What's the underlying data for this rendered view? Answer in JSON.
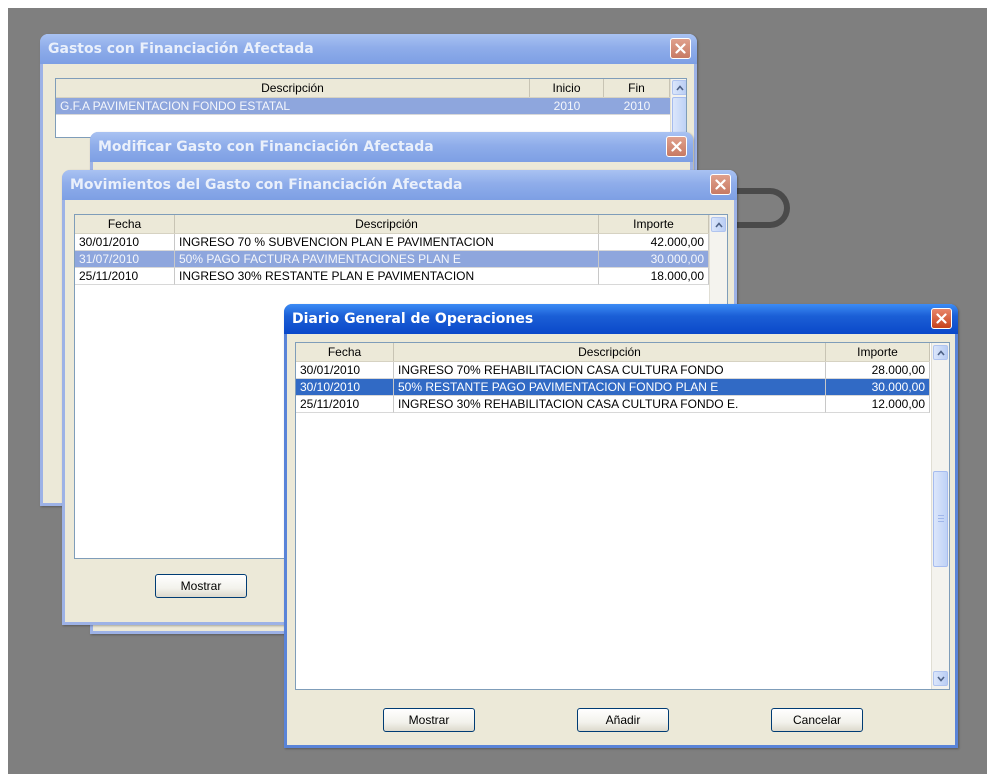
{
  "windows": {
    "gastos": {
      "title": "Gastos con Financiación Afectada",
      "columns": [
        "Descripción",
        "Inicio",
        "Fin"
      ],
      "rows": [
        {
          "descripcion": "G.F.A PAVIMENTACION FONDO ESTATAL",
          "inicio": "2010",
          "fin": "2010"
        }
      ]
    },
    "modificar": {
      "title": "Modificar Gasto con Financiación Afectada"
    },
    "movimientos": {
      "title": "Movimientos del Gasto con Financiación Afectada",
      "columns": [
        "Fecha",
        "Descripción",
        "Importe"
      ],
      "rows": [
        {
          "fecha": "30/01/2010",
          "descripcion": "INGRESO 70 % SUBVENCION PLAN E PAVIMENTACION",
          "importe": "42.000,00"
        },
        {
          "fecha": "31/07/2010",
          "descripcion": "50% PAGO FACTURA PAVIMENTACIONES PLAN E",
          "importe": "30.000,00"
        },
        {
          "fecha": "25/11/2010",
          "descripcion": "INGRESO 30% RESTANTE PLAN E PAVIMENTACION",
          "importe": "18.000,00"
        }
      ],
      "mostrar_label": "Mostrar"
    },
    "diario": {
      "title": "Diario General de Operaciones",
      "columns": [
        "Fecha",
        "Descripción",
        "Importe"
      ],
      "rows": [
        {
          "fecha": "30/01/2010",
          "descripcion": "INGRESO 70% REHABILITACION CASA CULTURA FONDO",
          "importe": "28.000,00"
        },
        {
          "fecha": "30/10/2010",
          "descripcion": "50% RESTANTE PAGO PAVIMENTACION FONDO PLAN E",
          "importe": "30.000,00"
        },
        {
          "fecha": "25/11/2010",
          "descripcion": "INGRESO 30% REHABILITACION CASA CULTURA FONDO E.",
          "importe": "12.000,00"
        }
      ],
      "mostrar_label": "Mostrar",
      "anadir_label": "Añadir",
      "cancelar_label": "Cancelar"
    }
  },
  "icons": {
    "close": "close-icon",
    "scroll_up": "chevron-up-icon",
    "scroll_down": "chevron-down-icon"
  },
  "colors": {
    "title_active": "#0a48c9",
    "title_inactive": "#8fadea",
    "selection": "#316ac5",
    "window_face": "#ece9d8",
    "close_button": "#c6421c"
  }
}
